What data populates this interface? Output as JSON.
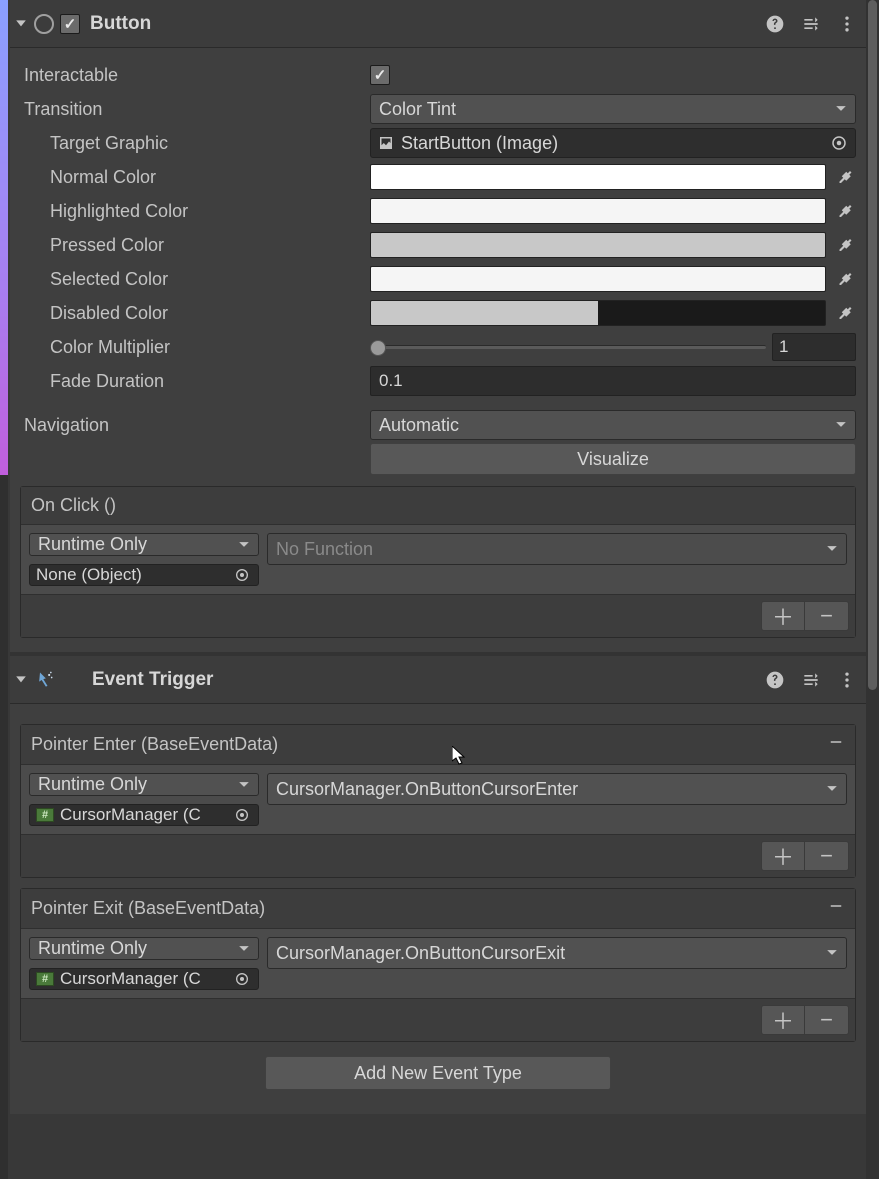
{
  "button_component": {
    "title": "Button",
    "fields": {
      "interactable": {
        "label": "Interactable",
        "checked": true
      },
      "transition": {
        "label": "Transition",
        "value": "Color Tint"
      },
      "target_graphic": {
        "label": "Target Graphic",
        "value": "StartButton (Image)"
      },
      "normal_color": {
        "label": "Normal Color",
        "hex": "#ffffff"
      },
      "highlighted_color": {
        "label": "Highlighted Color",
        "hex": "#f5f5f5"
      },
      "pressed_color": {
        "label": "Pressed Color",
        "hex": "#c8c8c8"
      },
      "selected_color": {
        "label": "Selected Color",
        "hex": "#f5f5f5"
      },
      "disabled_color": {
        "label": "Disabled Color",
        "hex": "#c8c8c880"
      },
      "color_multiplier": {
        "label": "Color Multiplier",
        "value": "1"
      },
      "fade_duration": {
        "label": "Fade Duration",
        "value": "0.1"
      },
      "navigation": {
        "label": "Navigation",
        "value": "Automatic"
      },
      "visualize": "Visualize"
    },
    "onclick": {
      "header": "On Click ()",
      "runtime": "Runtime Only",
      "func": "No Function",
      "target": "None (Object)"
    }
  },
  "event_trigger": {
    "title": "Event Trigger",
    "events": [
      {
        "header": "Pointer Enter (BaseEventData)",
        "runtime": "Runtime Only",
        "func": "CursorManager.OnButtonCursorEnter",
        "target": "CursorManager (C"
      },
      {
        "header": "Pointer Exit (BaseEventData)",
        "runtime": "Runtime Only",
        "func": "CursorManager.OnButtonCursorExit",
        "target": "CursorManager (C"
      }
    ],
    "add_btn": "Add New Event Type"
  }
}
